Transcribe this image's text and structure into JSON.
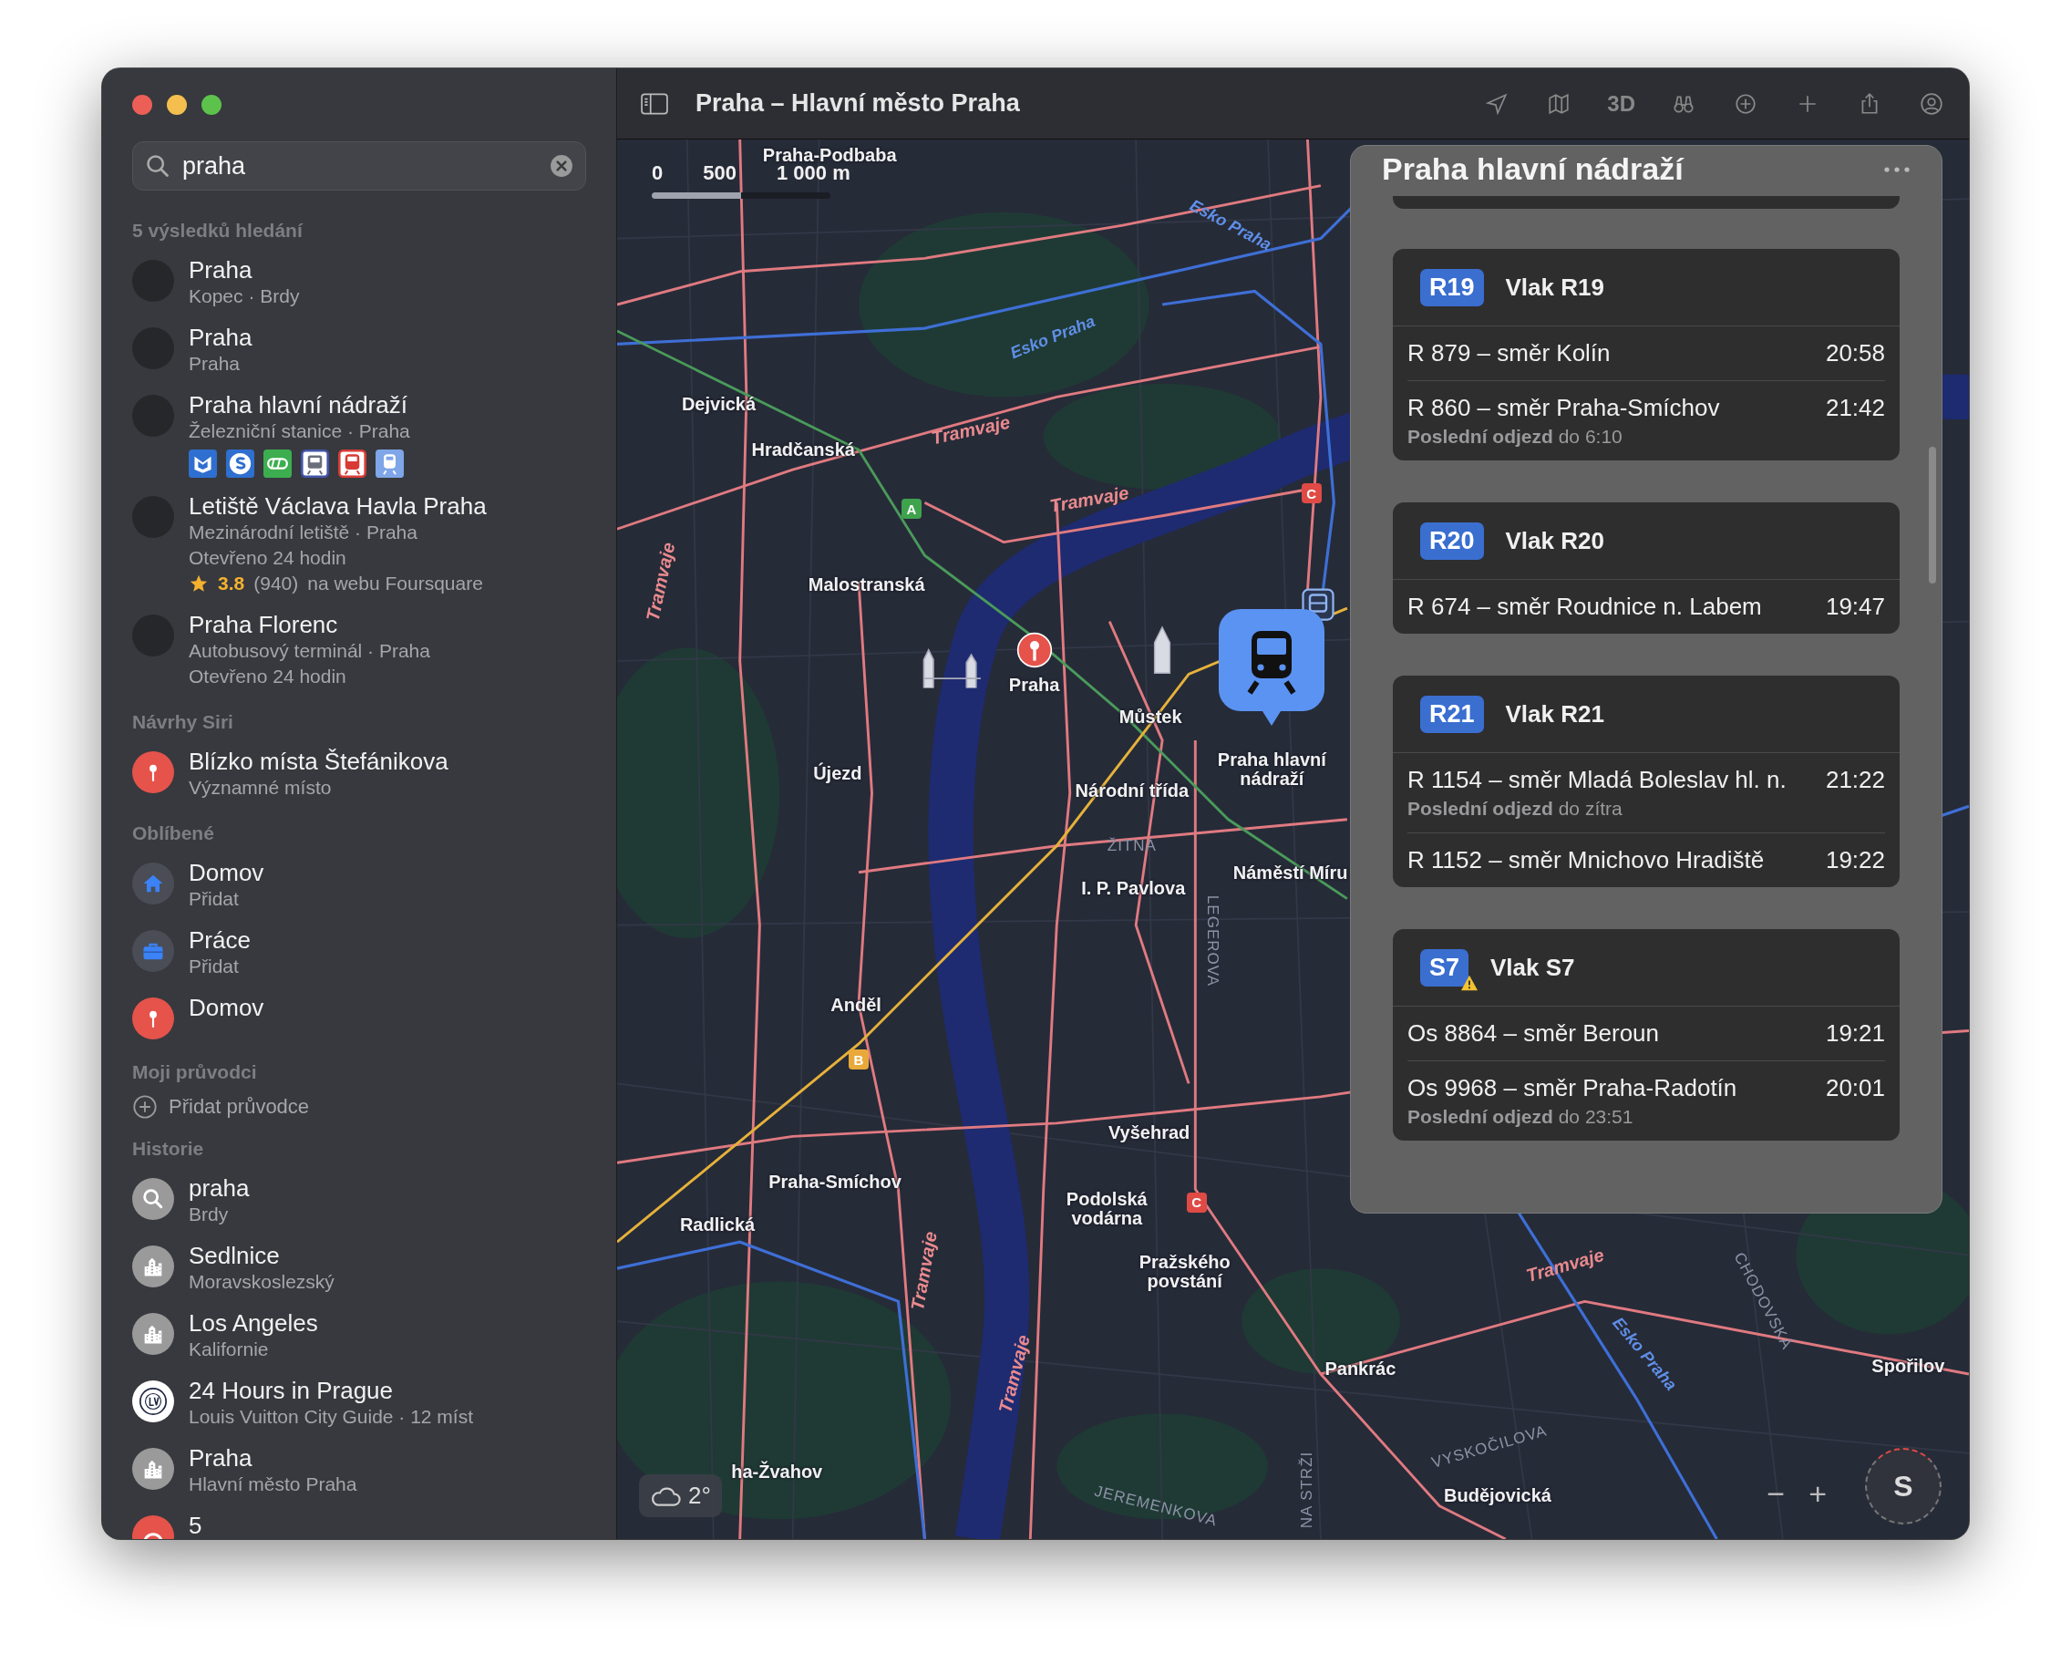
{
  "window": {
    "title": "Praha – Hlavní město Praha"
  },
  "sidebar": {
    "search": {
      "value": "praha"
    },
    "sections": [
      {
        "title": "5 výsledků hledání",
        "items": [
          {
            "kind": "place",
            "title": "Praha",
            "lines": [
              "Kopec · Brdy"
            ]
          },
          {
            "kind": "place",
            "title": "Praha",
            "lines": [
              "Praha"
            ]
          },
          {
            "kind": "station",
            "title": "Praha hlavní nádraží",
            "lines": [
              "Železniční stanice · Praha"
            ]
          },
          {
            "kind": "place",
            "title": "Letiště Václava Havla Praha",
            "lines": [
              "Mezinárodní letiště · Praha",
              "Otevřeno 24 hodin"
            ],
            "rating": {
              "value": "3.8",
              "count": "(940)",
              "source": "na webu Foursquare"
            }
          },
          {
            "kind": "place",
            "title": "Praha Florenc",
            "lines": [
              "Autobusový terminál · Praha",
              "Otevřeno 24 hodin"
            ]
          }
        ]
      },
      {
        "title": "Návrhy Siri",
        "items": [
          {
            "kind": "pin",
            "title": "Blízko místa Štefánikova",
            "lines": [
              "Významné místo"
            ]
          }
        ]
      },
      {
        "title": "Oblíbené",
        "items": [
          {
            "kind": "home",
            "title": "Domov",
            "lines": [
              "Přidat"
            ]
          },
          {
            "kind": "work",
            "title": "Práce",
            "lines": [
              "Přidat"
            ]
          },
          {
            "kind": "pin",
            "title": "Domov"
          }
        ]
      },
      {
        "title": "Moji průvodci",
        "items": [
          {
            "kind": "add",
            "title": "Přidat průvodce"
          }
        ]
      },
      {
        "title": "Historie",
        "items": [
          {
            "kind": "search",
            "title": "praha",
            "lines": [
              "Brdy"
            ]
          },
          {
            "kind": "city",
            "title": "Sedlnice",
            "lines": [
              "Moravskoslezský"
            ]
          },
          {
            "kind": "city",
            "title": "Los Angeles",
            "lines": [
              "Kalifornie"
            ]
          },
          {
            "kind": "guide",
            "title": "24 Hours in Prague",
            "lines": [
              "Louis Vuitton City Guide · 12 míst"
            ]
          },
          {
            "kind": "city",
            "title": "Praha",
            "lines": [
              "Hlavní město Praha"
            ]
          },
          {
            "kind": "directions",
            "title": "5"
          }
        ]
      }
    ]
  },
  "toolbar": {
    "view_mode": "3D"
  },
  "map": {
    "scale": [
      "0",
      "500",
      "1 000 m"
    ],
    "weather": "2°",
    "labels": [
      {
        "kind": "place",
        "text": "Praha-Podbaba"
      },
      {
        "kind": "rail",
        "text": "Esko Praha"
      },
      {
        "kind": "rail",
        "text": "Esko Praha"
      },
      {
        "kind": "place",
        "text": "Dejvická"
      },
      {
        "kind": "tram",
        "text": "Tramvaje"
      },
      {
        "kind": "place",
        "text": "Hradčanská"
      },
      {
        "kind": "tram",
        "text": "Tramvaje"
      },
      {
        "kind": "tram",
        "text": "Tramvaje"
      },
      {
        "kind": "place",
        "text": "Malostranská"
      },
      {
        "kind": "place",
        "text": "Praha"
      },
      {
        "kind": "place",
        "text": "Můstek"
      },
      {
        "kind": "place",
        "text": "Újezd"
      },
      {
        "kind": "place",
        "text": "Praha hlavní nádraží"
      },
      {
        "kind": "place",
        "text": "Národní třída"
      },
      {
        "kind": "street",
        "text": "ŽITNÁ"
      },
      {
        "kind": "place",
        "text": "I. P. Pavlova"
      },
      {
        "kind": "place",
        "text": "Náměstí Míru"
      },
      {
        "kind": "street",
        "text": "LEGEROVA"
      },
      {
        "kind": "place",
        "text": "Anděl"
      },
      {
        "kind": "place",
        "text": "Vyšehrad"
      },
      {
        "kind": "place",
        "text": "Praha-Smíchov"
      },
      {
        "kind": "place",
        "text": "Podolská vodárna"
      },
      {
        "kind": "place",
        "text": "Radlická"
      },
      {
        "kind": "tram",
        "text": "Tramvaje"
      },
      {
        "kind": "tram",
        "text": "Tramvaje"
      },
      {
        "kind": "place",
        "text": "Pražského povstání"
      },
      {
        "kind": "street",
        "text": "CHODOVSKÁ"
      },
      {
        "kind": "rail",
        "text": "Esko Praha"
      },
      {
        "kind": "place",
        "text": "Pankrác"
      },
      {
        "kind": "place",
        "text": "Spořilov"
      },
      {
        "kind": "tram",
        "text": "Tramvaje"
      },
      {
        "kind": "street",
        "text": "VYSKOČILOVA"
      },
      {
        "kind": "place",
        "text": "ha-Žvahov"
      },
      {
        "kind": "place",
        "text": "Budějovická"
      },
      {
        "kind": "street",
        "text": "JEREMENKOVA"
      },
      {
        "kind": "street",
        "text": "NA STRŽI"
      }
    ],
    "metro_badges": [
      {
        "text": "A",
        "color": "#3fa34d"
      },
      {
        "text": "B",
        "color": "#e8a93a"
      },
      {
        "text": "C",
        "color": "#e04a45"
      },
      {
        "text": "C",
        "color": "#e04a45"
      }
    ],
    "zoom": [
      "−",
      "+"
    ],
    "compass": "S"
  },
  "panel": {
    "title": "Praha hlavní nádraží",
    "routes": [
      {
        "badge": "R19",
        "name": "Vlak R19",
        "alert": false,
        "departures": [
          {
            "text": "R 879 – směr Kolín",
            "time": "20:58"
          },
          {
            "text": "R 860 – směr Praha-Smíchov",
            "time": "21:42",
            "note": "**Poslední odjezd** do 6:10"
          }
        ]
      },
      {
        "badge": "R20",
        "name": "Vlak R20",
        "alert": false,
        "departures": [
          {
            "text": "R 674 – směr Roudnice n. Labem",
            "time": "19:47"
          }
        ]
      },
      {
        "badge": "R21",
        "name": "Vlak R21",
        "alert": false,
        "departures": [
          {
            "text": "R 1154 – směr Mladá Boleslav hl. n.",
            "time": "21:22",
            "note": "**Poslední odjezd** do zítra"
          },
          {
            "text": "R 1152 – směr Mnichovo Hradiště",
            "time": "19:22"
          }
        ]
      },
      {
        "badge": "S7",
        "name": "Vlak S7",
        "alert": true,
        "departures": [
          {
            "text": "Os 8864 – směr Beroun",
            "time": "19:21"
          },
          {
            "text": "Os 9968 – směr Praha-Radotín",
            "time": "20:01",
            "note": "**Poslední odjezd** do 23:51"
          }
        ]
      }
    ]
  }
}
